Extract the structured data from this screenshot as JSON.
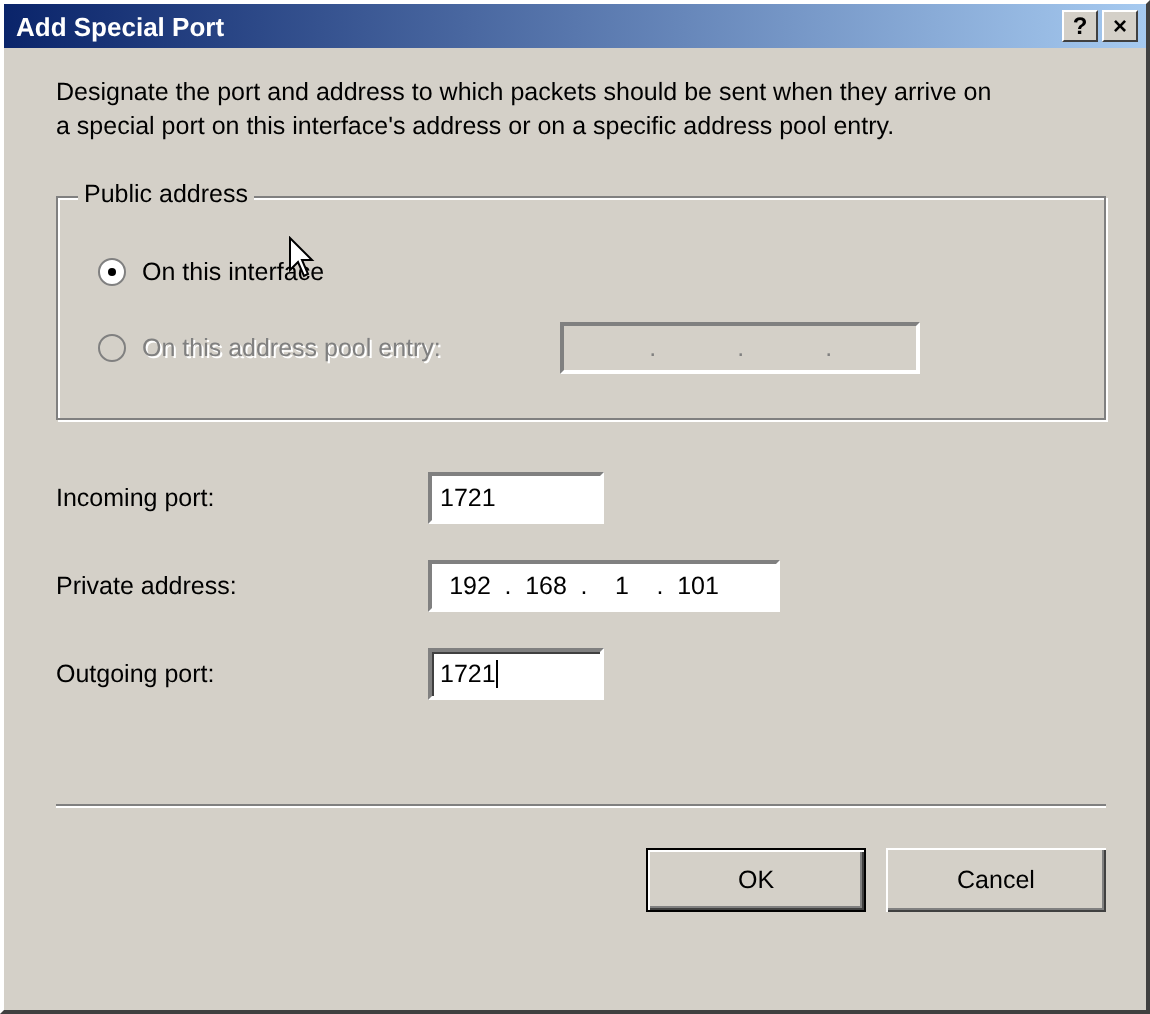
{
  "window": {
    "title": "Add Special Port",
    "help_button": "?",
    "close_button": "×"
  },
  "description": "Designate the port and address to which packets should be sent when they arrive on a special port on this interface's address or on a specific address pool entry.",
  "public_address": {
    "label": "Public address",
    "options": [
      {
        "label": "On this interface",
        "selected": true,
        "disabled": false
      },
      {
        "label": "On this address pool entry:",
        "selected": false,
        "disabled": true
      }
    ],
    "pool_address": {
      "separators": [
        ".",
        ".",
        "."
      ],
      "disabled": true
    }
  },
  "fields": [
    {
      "label": "Incoming port:",
      "kind": "text",
      "value": "1721",
      "focused": false
    },
    {
      "label": "Private address:",
      "kind": "ip",
      "octets": [
        "192",
        "168",
        "1",
        "101"
      ],
      "separators": [
        ".",
        ".",
        "."
      ]
    },
    {
      "label": "Outgoing port:",
      "kind": "text",
      "value": "1721",
      "focused": true
    }
  ],
  "buttons": [
    {
      "label": "OK",
      "default": true
    },
    {
      "label": "Cancel",
      "default": false
    }
  ]
}
